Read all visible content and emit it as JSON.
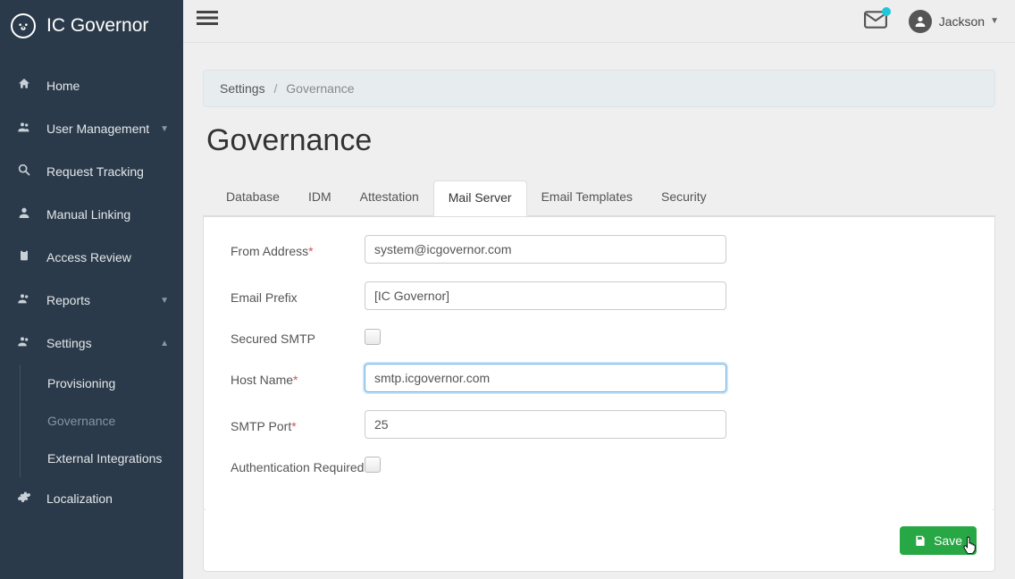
{
  "brand": "IC Governor",
  "user": {
    "name": "Jackson"
  },
  "sidebar": {
    "items": [
      {
        "label": "Home"
      },
      {
        "label": "User Management"
      },
      {
        "label": "Request Tracking"
      },
      {
        "label": "Manual Linking"
      },
      {
        "label": "Access Review"
      },
      {
        "label": "Reports"
      },
      {
        "label": "Settings"
      },
      {
        "label": "Localization"
      }
    ],
    "settings_sub": [
      {
        "label": "Provisioning"
      },
      {
        "label": "Governance"
      },
      {
        "label": "External Integrations"
      }
    ]
  },
  "breadcrumb": {
    "root": "Settings",
    "current": "Governance"
  },
  "page": {
    "title": "Governance"
  },
  "tabs": [
    {
      "label": "Database"
    },
    {
      "label": "IDM"
    },
    {
      "label": "Attestation"
    },
    {
      "label": "Mail Server"
    },
    {
      "label": "Email Templates"
    },
    {
      "label": "Security"
    }
  ],
  "form": {
    "from_address": {
      "label": "From Address",
      "value": "system@icgovernor.com"
    },
    "email_prefix": {
      "label": "Email Prefix",
      "value": "[IC Governor]"
    },
    "secured_smtp": {
      "label": "Secured SMTP",
      "checked": false
    },
    "host_name": {
      "label": "Host Name",
      "value": "smtp.icgovernor.com"
    },
    "smtp_port": {
      "label": "SMTP Port",
      "value": "25"
    },
    "auth_required": {
      "label": "Authentication Required",
      "checked": false
    }
  },
  "actions": {
    "save": "Save"
  }
}
